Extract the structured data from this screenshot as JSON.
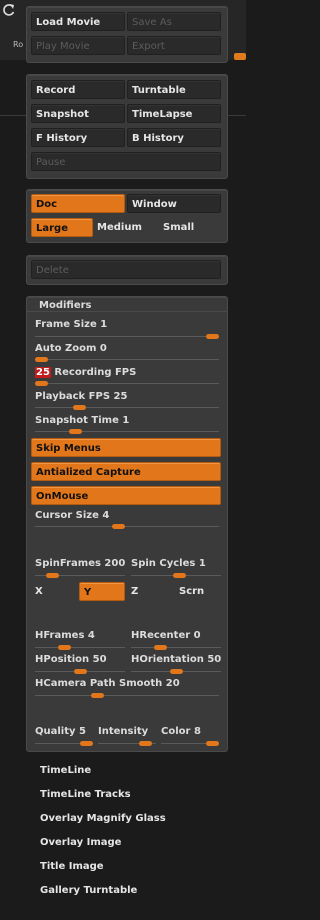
{
  "colors": {
    "accent": "#e2761b",
    "panel": "#3a3a3a",
    "button": "#2a2a2a",
    "fps_badge": "#c01c1c"
  },
  "background": {
    "partial_label": "Ro"
  },
  "movie": {
    "load": "Load Movie",
    "save_as": "Save As",
    "play": "Play Movie",
    "export": "Export"
  },
  "record": {
    "record": "Record",
    "turntable": "Turntable",
    "snapshot": "Snapshot",
    "timelapse": "TimeLapse",
    "f_history": "F History",
    "b_history": "B History",
    "pause": "Pause"
  },
  "mode": {
    "doc": "Doc",
    "window": "Window",
    "large": "Large",
    "medium": "Medium",
    "small": "Small"
  },
  "delete": "Delete",
  "modifiers": {
    "title": "Modifiers",
    "frame_size": {
      "label": "Frame Size",
      "value": "1",
      "level": 1.0
    },
    "auto_zoom": {
      "label": "Auto Zoom",
      "value": "0",
      "level": 0.0
    },
    "recording_fps": {
      "value": "25",
      "label": "Recording FPS",
      "level": 0.0
    },
    "playback_fps": {
      "label": "Playback FPS",
      "value": "25",
      "level": 0.22
    },
    "snapshot_time": {
      "label": "Snapshot Time",
      "value": "1",
      "level": 0.2
    },
    "skip_menus": "Skip Menus",
    "antialized_capture": "Antialized Capture",
    "onmouse": "OnMouse",
    "cursor_size": {
      "label": "Cursor Size",
      "value": "4",
      "level": 0.45
    },
    "spin_frames": {
      "label": "SpinFrames",
      "value": "200",
      "level": 0.14
    },
    "spin_cycles": {
      "label": "Spin Cycles",
      "value": "1",
      "level": 0.55
    },
    "axis": {
      "x": "X",
      "y": "Y",
      "z": "Z",
      "scrn": "Scrn"
    },
    "hframes": {
      "label": "HFrames",
      "value": "4",
      "level": 0.3
    },
    "hrecenter": {
      "label": "HRecenter",
      "value": "0",
      "level": 0.3
    },
    "hposition": {
      "label": "HPosition",
      "value": "50",
      "level": 0.5
    },
    "horientation": {
      "label": "HOrientation",
      "value": "50",
      "level": 0.5
    },
    "hcamera_path_smooth": {
      "label": "HCamera Path Smooth",
      "value": "20",
      "level": 0.33
    },
    "quality": {
      "label": "Quality",
      "value": "5",
      "level": 1.0
    },
    "intensity": {
      "label": "Intensity",
      "value": "",
      "level": 0.9
    },
    "color": {
      "label": "Color",
      "value": "8",
      "level": 1.0
    }
  },
  "list": [
    "TimeLine",
    "TimeLine Tracks",
    "Overlay Magnify Glass",
    "Overlay Image",
    "Title Image",
    "Gallery Turntable"
  ]
}
